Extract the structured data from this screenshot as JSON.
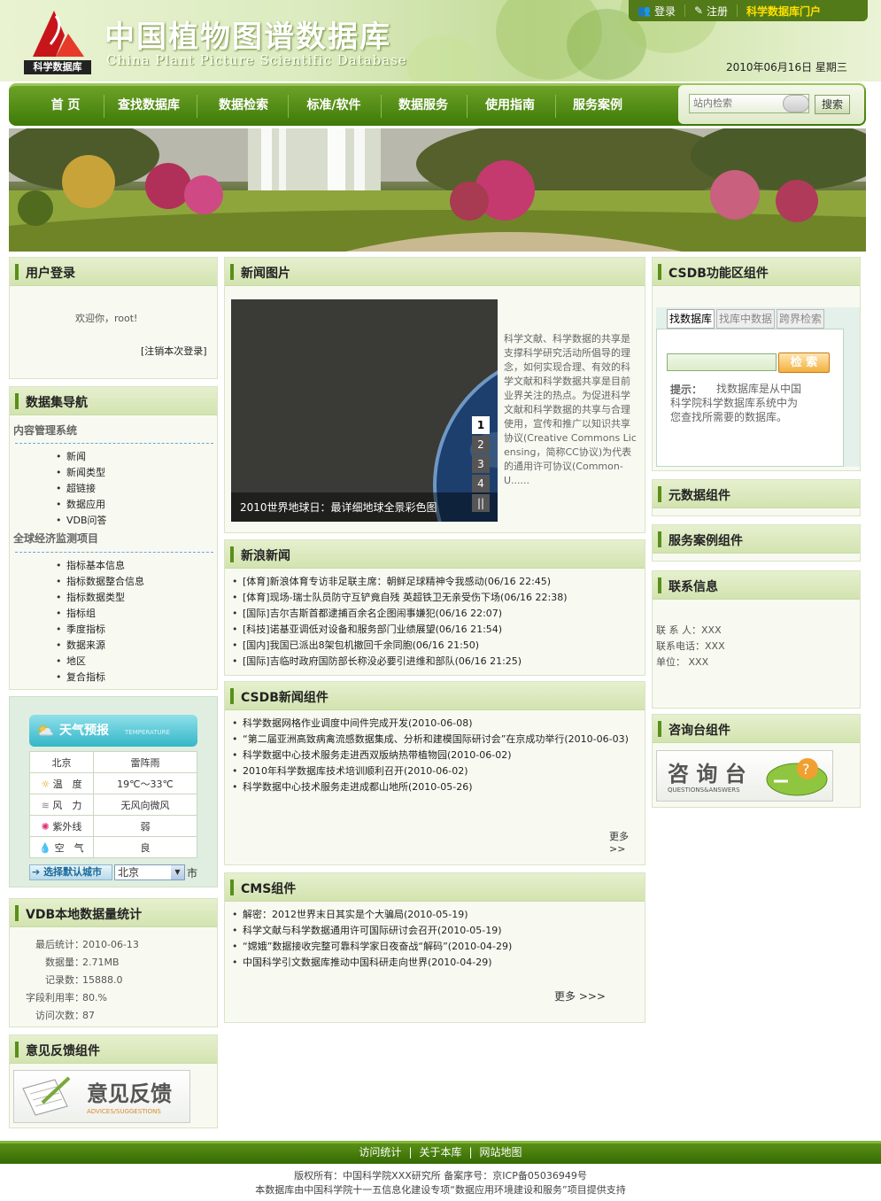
{
  "header": {
    "title": "中国植物图谱数据库",
    "subtitle": "China Plant Picture Scientific Database",
    "logo_text": "科学数据库",
    "top_links": [
      "登录",
      "注册",
      "科学数据库门户"
    ],
    "date": "2010年06月16日   星期三"
  },
  "nav": {
    "items": [
      "首 页",
      "查找数据库",
      "数据检索",
      "标准/软件",
      "数据服务",
      "使用指南",
      "服务案例"
    ],
    "search_placeholder": "站内检索",
    "search_button": "搜索"
  },
  "login": {
    "title": "用户登录",
    "welcome": "欢迎你，root!",
    "logout": "[注销本次登录]"
  },
  "dataset_nav": {
    "title": "数据集导航",
    "groups": [
      {
        "name": "内容管理系统",
        "items": [
          "新闻",
          "新闻类型",
          "超链接",
          "数据应用",
          "VDB问答"
        ]
      },
      {
        "name": "全球经济监测项目",
        "items": [
          "指标基本信息",
          "指标数据整合信息",
          "指标数据类型",
          "指标组",
          "季度指标",
          "数据来源",
          "地区",
          "复合指标"
        ]
      }
    ]
  },
  "weather": {
    "title": "天气预报",
    "title_en": "TEMPERATURE",
    "city": "北京",
    "condition": "雷阵雨",
    "rows": [
      {
        "icon": "sun-icon",
        "label": "温　度",
        "value": "19℃～33℃"
      },
      {
        "icon": "wind-icon",
        "label": "风　力",
        "value": "无风向微风"
      },
      {
        "icon": "uv-icon",
        "label": "紫外线",
        "value": "弱"
      },
      {
        "icon": "drop-icon",
        "label": "空　气",
        "value": "良"
      }
    ],
    "choose_label": "选择默认城市",
    "select_value": "北京",
    "suffix": "市"
  },
  "vdb_stats": {
    "title": "VDB本地数据量统计",
    "rows": [
      {
        "k": "最后统计：",
        "v": "2010-06-13"
      },
      {
        "k": "数据量：",
        "v": "2.71MB"
      },
      {
        "k": "记录数：",
        "v": "15888.0"
      },
      {
        "k": "字段利用率：",
        "v": "80.%"
      },
      {
        "k": "访问次数：",
        "v": "87"
      }
    ]
  },
  "feedback": {
    "title": "意见反馈组件",
    "img_title": "意见反馈",
    "img_sub": "ADVICES/SUGGESTIONS"
  },
  "news_pic": {
    "title": "新闻图片",
    "caption": "2010世界地球日：最详细地球全景彩色图",
    "pager": [
      "1",
      "2",
      "3",
      "4",
      "||"
    ],
    "text": "科学文献、科学数据的共享是支撑科学研究活动所倡导的理念，如何实现合理、有效的科学文献和科学数据共享是目前业界关注的热点。为促进科学文献和科学数据的共享与合理使用，宣传和推广以知识共享协议(Creative Commons Licensing，简称CC协议)为代表的通用许可协议(Common-U......"
  },
  "sina_news": {
    "title": "新浪新闻",
    "items": [
      "[体育]新浪体育专访非足联主席：朝鲜足球精神令我感动(06/16 22:45)",
      "[体育]现场-瑞士队员防守互铲竟自残 英超铁卫无亲受伤下场(06/16 22:38)",
      "[国际]吉尔吉斯首都逮捕百余名企图闹事嫌犯(06/16 22:07)",
      "[科技]诺基亚调低对设备和服务部门业绩展望(06/16 21:54)",
      "[国内]我国已派出8架包机撤回千余同胞(06/16 21:50)",
      "[国际]吉临时政府国防部长称没必要引进维和部队(06/16 21:25)"
    ]
  },
  "csdb_news": {
    "title": "CSDB新闻组件",
    "more": "更多>>",
    "items": [
      "科学数据网格作业调度中间件完成开发(2010-06-08)",
      "“第二届亚洲高致病禽流感数据集成、分析和建模国际研讨会”在京成功举行(2010-06-03)",
      "科学数据中心技术服务走进西双版纳热带植物园(2010-06-02)",
      "2010年科学数据库技术培训顺利召开(2010-06-02)",
      "科学数据中心技术服务走进成都山地所(2010-05-26)"
    ]
  },
  "cms": {
    "title": "CMS组件",
    "more": "更多 >>>",
    "items": [
      "解密：2012世界末日其实是个大骗局(2010-05-19)",
      "科学文献与科学数据通用许可国际研讨会召开(2010-05-19)",
      "“嫦娥”数据接收完整可靠科学家日夜奋战“解码”(2010-04-29)",
      "中国科学引文数据库推动中国科研走向世界(2010-04-29)"
    ]
  },
  "csdb_func": {
    "title": "CSDB功能区组件",
    "tabs": [
      "找数据库",
      "找库中数据",
      "跨界检索"
    ],
    "search_button": "检 索",
    "hint_label": "提示：",
    "hint": "找数据库是从中国科学院科学数据库系统中为您查找所需要的数据库。"
  },
  "meta": {
    "title": "元数据组件"
  },
  "cases": {
    "title": "服务案例组件"
  },
  "contact": {
    "title": "联系信息",
    "rows": [
      "联 系 人：XXX",
      "联系电话：XXX",
      "单位： XXX"
    ]
  },
  "consult": {
    "title": "咨询台组件",
    "img_title": "咨 询 台",
    "img_sub": "QUESTIONS&ANSWERS"
  },
  "footer": {
    "links": [
      "访问统计",
      "关于本库",
      "网站地图"
    ],
    "line1": "版权所有：中国科学院XXX研究所  备案序号：京ICP备05036949号",
    "line2": "本数据库由中国科学院十一五信息化建设专项“数据应用环境建设和服务”项目提供支持"
  }
}
